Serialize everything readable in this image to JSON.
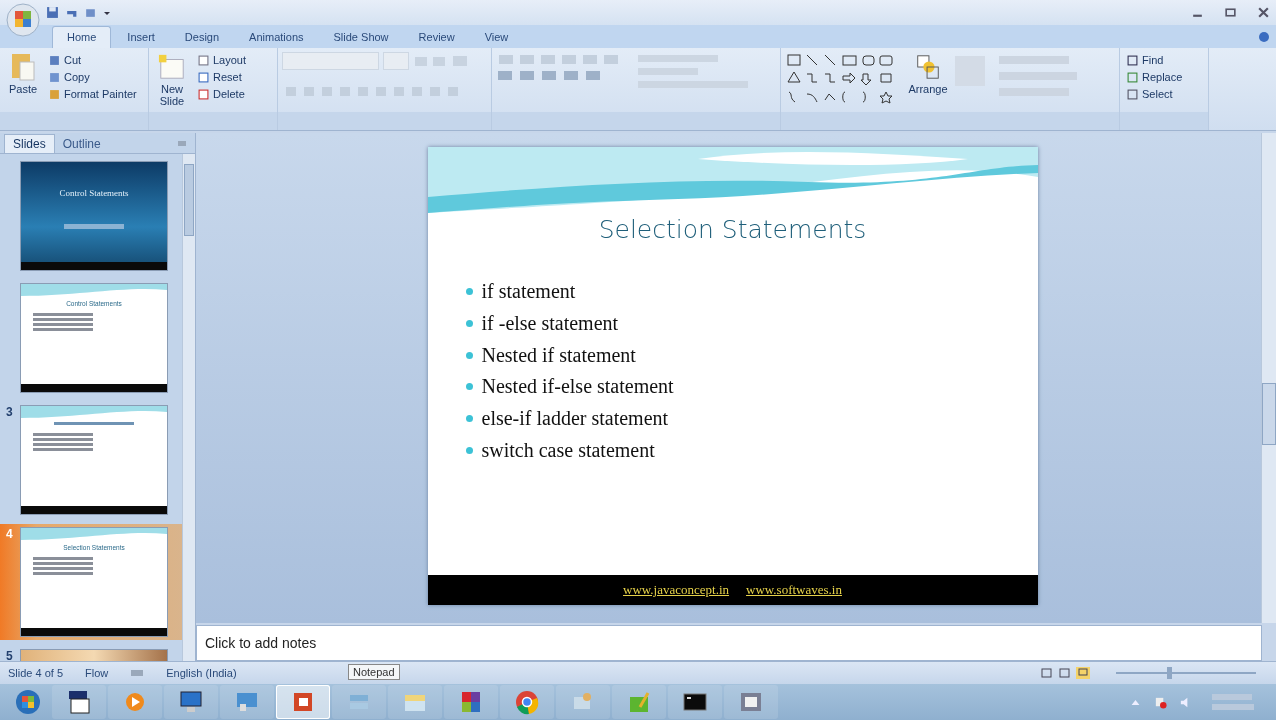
{
  "tabs": [
    {
      "label": "Home",
      "selected": true
    },
    {
      "label": "Insert",
      "selected": false
    },
    {
      "label": "Design",
      "selected": false
    },
    {
      "label": "Animations",
      "selected": false
    },
    {
      "label": "Slide Show",
      "selected": false
    },
    {
      "label": "Review",
      "selected": false
    },
    {
      "label": "View",
      "selected": false
    }
  ],
  "clipboard": {
    "big": "Paste",
    "items": [
      "Cut",
      "Copy",
      "Format Painter"
    ]
  },
  "slides_group": {
    "big": "New Slide",
    "items": [
      "Layout",
      "Reset",
      "Delete"
    ]
  },
  "drawing": {
    "big": "Arrange"
  },
  "editing": [
    "Find",
    "Replace",
    "Select"
  ],
  "panel_tabs": [
    {
      "label": "Slides",
      "selected": true
    },
    {
      "label": "Outline",
      "selected": false
    }
  ],
  "thumbnails": [
    {
      "kind": "title",
      "title": "Control Statements",
      "selected": false
    },
    {
      "kind": "content",
      "title": "Control Statements",
      "selected": false
    },
    {
      "kind": "content",
      "number": "3",
      "selected": false
    },
    {
      "kind": "content",
      "number": "4",
      "title": "Selection Statements",
      "selected": true
    },
    {
      "kind": "partial",
      "number": "5",
      "selected": false
    }
  ],
  "slide": {
    "title": "Selection Statements",
    "bullets": [
      "if statement",
      "if -else statement",
      "Nested if statement",
      "Nested if-else statement",
      "else-if ladder statement",
      "switch case statement"
    ],
    "footer_links": [
      "www.javaconcept.in",
      "www.softwaves.in"
    ]
  },
  "notes_placeholder": "Click to add notes",
  "status_bar": {
    "slide": "Slide 4 of 5",
    "theme": "Flow",
    "language": "English (India)",
    "zoom": {
      "level": 0.38
    }
  },
  "tooltip": "Notepad",
  "taskbar": [
    {
      "kind": "start",
      "selected": false
    },
    {
      "kind": "calculator",
      "selected": false
    },
    {
      "kind": "media",
      "selected": false
    },
    {
      "kind": "computer",
      "selected": false
    },
    {
      "kind": "network",
      "selected": false
    },
    {
      "kind": "powerpoint",
      "selected": true
    },
    {
      "kind": "stack",
      "selected": false
    },
    {
      "kind": "folder",
      "selected": false
    },
    {
      "kind": "office",
      "selected": false
    },
    {
      "kind": "chrome",
      "selected": false
    },
    {
      "kind": "tool",
      "selected": false
    },
    {
      "kind": "notepad",
      "selected": false
    },
    {
      "kind": "console",
      "selected": false
    },
    {
      "kind": "window",
      "selected": false
    }
  ]
}
